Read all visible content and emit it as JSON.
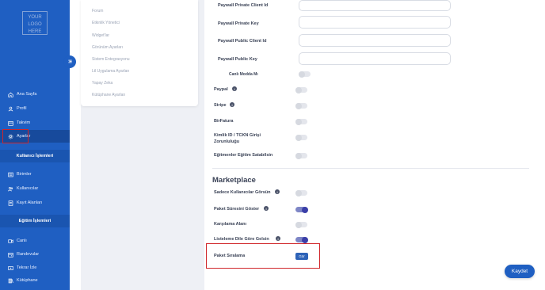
{
  "logo": {
    "text": "YOUR LOGO HERE"
  },
  "sidebar": {
    "items": [
      {
        "label": "Ana Sayfa",
        "icon": "home-icon"
      },
      {
        "label": "Profil",
        "icon": "user-icon"
      },
      {
        "label": "Takvim",
        "icon": "calendar-icon"
      },
      {
        "label": "Ayarlar",
        "icon": "gear-icon"
      }
    ],
    "sections": [
      {
        "title": "Kullanıcı İşlemleri",
        "items": [
          {
            "label": "Birimler",
            "icon": "list-icon"
          },
          {
            "label": "Kullanıcılar",
            "icon": "users-icon"
          },
          {
            "label": "Kayıt Alanları",
            "icon": "form-icon"
          }
        ]
      },
      {
        "title": "Eğitim İşlemleri",
        "items": [
          {
            "label": "Canlı",
            "icon": "video-icon"
          },
          {
            "label": "Randevular",
            "icon": "appointment-icon"
          },
          {
            "label": "Tekrar İzle",
            "icon": "replay-icon"
          },
          {
            "label": "Kütüphane",
            "icon": "library-icon"
          }
        ]
      }
    ]
  },
  "submenu": {
    "items": [
      "Forum",
      "Etkinlik Yönetici",
      "Widget'lar",
      "Görünüm Ayarları",
      "Sistem Entegrasyonu",
      "Ltl Uygulama Ayarları",
      "Yapay Zeka",
      "Kütüphane Ayarları"
    ]
  },
  "paywall": {
    "private_client_id": "Paywall Private Client Id",
    "private_key": "Paywall Private Key",
    "public_client_id": "Paywall Public Client Id",
    "public_key": "Paywall Public Key",
    "canli_modda": "Canlı Modda Mı"
  },
  "settings": {
    "paypal": "Paypal",
    "stripe": "Stripe",
    "birfatura": "BirFatura",
    "kimlik": "Kimlik ID / TCKN Girişi Zorunluluğu",
    "egitmenler": "Eğitmenler Eğitim Satabilsin"
  },
  "marketplace": {
    "title": "Marketplace",
    "sadece": "Sadece Kullanıcılar Görsün",
    "paket_suresi": "Paket Süresini Göster",
    "karsilama": "Karşılama Alanı",
    "listeleme": "Listeleme Dile Göre Gelsin",
    "paket_siralama": "Paket Sıralama",
    "gor_label": "Gör"
  },
  "toggles": {
    "canli_modda": false,
    "paypal": false,
    "stripe": false,
    "birfatura": false,
    "kimlik": false,
    "egitmenler": false,
    "sadece": false,
    "paket_suresi": true,
    "karsilama": false,
    "listeleme": true
  },
  "save_label": "Kaydet",
  "colors": {
    "primary": "#1f5fc2",
    "highlight": "#d0262a",
    "toggle_on": "#3b3fa8"
  }
}
